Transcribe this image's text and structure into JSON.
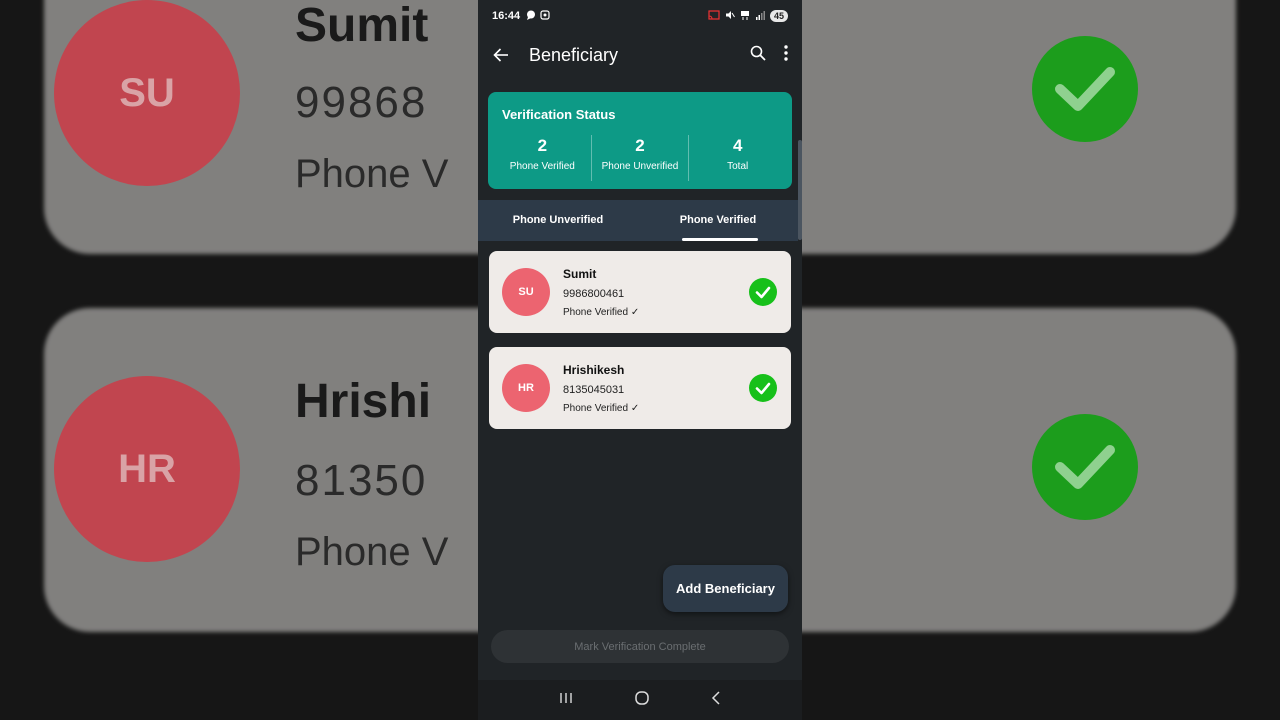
{
  "status_bar": {
    "time": "16:44",
    "battery": "45"
  },
  "appbar": {
    "title": "Beneficiary"
  },
  "verification": {
    "title": "Verification Status",
    "stats": [
      {
        "value": "2",
        "label": "Phone Verified"
      },
      {
        "value": "2",
        "label": "Phone Unverified"
      },
      {
        "value": "4",
        "label": "Total"
      }
    ]
  },
  "tabs": [
    {
      "label": "Phone Unverified",
      "active": false
    },
    {
      "label": "Phone Verified",
      "active": true
    }
  ],
  "beneficiaries": [
    {
      "initials": "SU",
      "name": "Sumit",
      "phone": "9986800461",
      "status": "Phone Verified ✓"
    },
    {
      "initials": "HR",
      "name": "Hrishikesh",
      "phone": "8135045031",
      "status": "Phone Verified ✓"
    }
  ],
  "fab_label": "Add Beneficiary",
  "complete_label": "Mark Verification Complete",
  "background": {
    "cards": [
      {
        "initials": "SU",
        "name": "Sumit",
        "phone": "99868",
        "status": "Phone V"
      },
      {
        "initials": "HR",
        "name": "Hrishi",
        "phone": "81350",
        "status": "Phone V"
      }
    ]
  },
  "colors": {
    "accent": "#0d9a86",
    "tab_bg": "#2d3a48",
    "avatar": "#ec6470",
    "check": "#17c01a"
  }
}
